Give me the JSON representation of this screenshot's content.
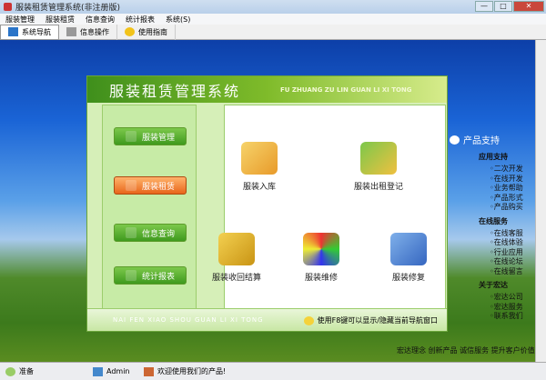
{
  "window": {
    "title": "服装租赁管理系统(非注册版)",
    "min": "—",
    "max": "□",
    "close": "✕"
  },
  "menu": [
    "服装管理",
    "服装租赁",
    "信息查询",
    "统计报表",
    "系统(S)"
  ],
  "toolbar": [
    "系统导航",
    "信息操作",
    "使用指南"
  ],
  "dialog": {
    "title": "服装租赁管理系统",
    "subtitle": "FU ZHUANG ZU LIN GUAN LI XI TONG",
    "nav": [
      "服装管理",
      "服装租赁",
      "信息查询",
      "统计报表"
    ],
    "functions": [
      "服装入库",
      "服装出租登记",
      "服装收回结算",
      "服装维修",
      "服装修复"
    ],
    "footer_pinyin": "NAI FEN XIAO SHOU GUAN LI XI TONG",
    "footer_hint": "使用F8键可以显示/隐藏当前导航窗口"
  },
  "side": {
    "title": "产品支持",
    "sections": [
      {
        "title": "应用支持",
        "items": [
          "二次开发",
          "在线开发",
          "业务帮助",
          "产品形式",
          "产品购买"
        ]
      },
      {
        "title": "在线服务",
        "items": [
          "在线客服",
          "在线体验",
          "行业应用",
          "在线论坛",
          "在线留言"
        ]
      },
      {
        "title": "关于宏达",
        "items": [
          "宏达公司",
          "宏达服务",
          "联系我们"
        ]
      }
    ],
    "tagline": "宏达理念 创新产品 诚信服务 提升客户价值"
  },
  "status": [
    "准备",
    "Admin",
    "欢迎使用我们的产品!"
  ]
}
